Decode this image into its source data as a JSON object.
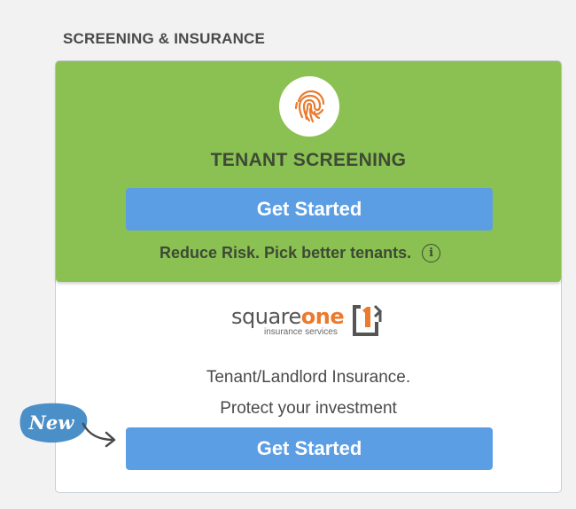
{
  "section": {
    "title": "SCREENING & INSURANCE"
  },
  "screening": {
    "icon": "fingerprint-icon",
    "title": "TENANT SCREENING",
    "button_label": "Get Started",
    "tagline": "Reduce Risk. Pick better tenants.",
    "info_glyph": "i",
    "panel_color": "#8bc152"
  },
  "insurance": {
    "logo": {
      "word1": "square",
      "word2": "one",
      "subtitle": "insurance services"
    },
    "line1": "Tenant/Landlord Insurance.",
    "line2": "Protect your investment",
    "button_label": "Get Started",
    "badge": "New"
  },
  "colors": {
    "button": "#5b9ee4",
    "accent_orange": "#ea7b2e",
    "badge": "#4a8fc8"
  }
}
